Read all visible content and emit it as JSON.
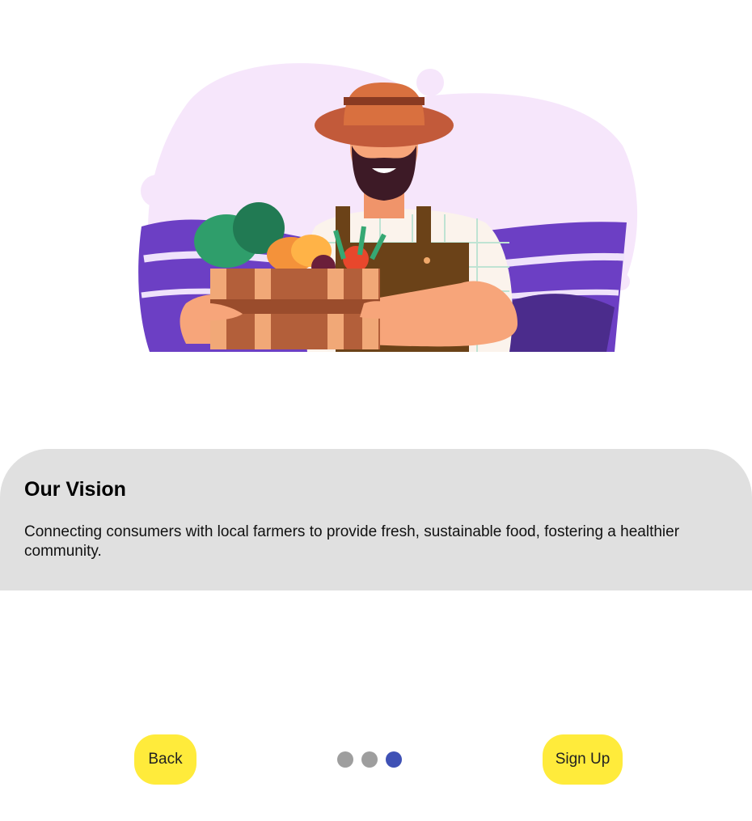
{
  "onboarding": {
    "title": "Our Vision",
    "description": "Connecting consumers with local farmers to provide fresh, sustainable food, fostering a healthier community.",
    "back_label": "Back",
    "signup_label": "Sign Up",
    "page_count": 3,
    "current_page": 3,
    "colors": {
      "button": "#ffeb3b",
      "card": "#e0e0e0",
      "dot_active": "#3f51b5",
      "dot_inactive": "#9e9e9e"
    }
  }
}
